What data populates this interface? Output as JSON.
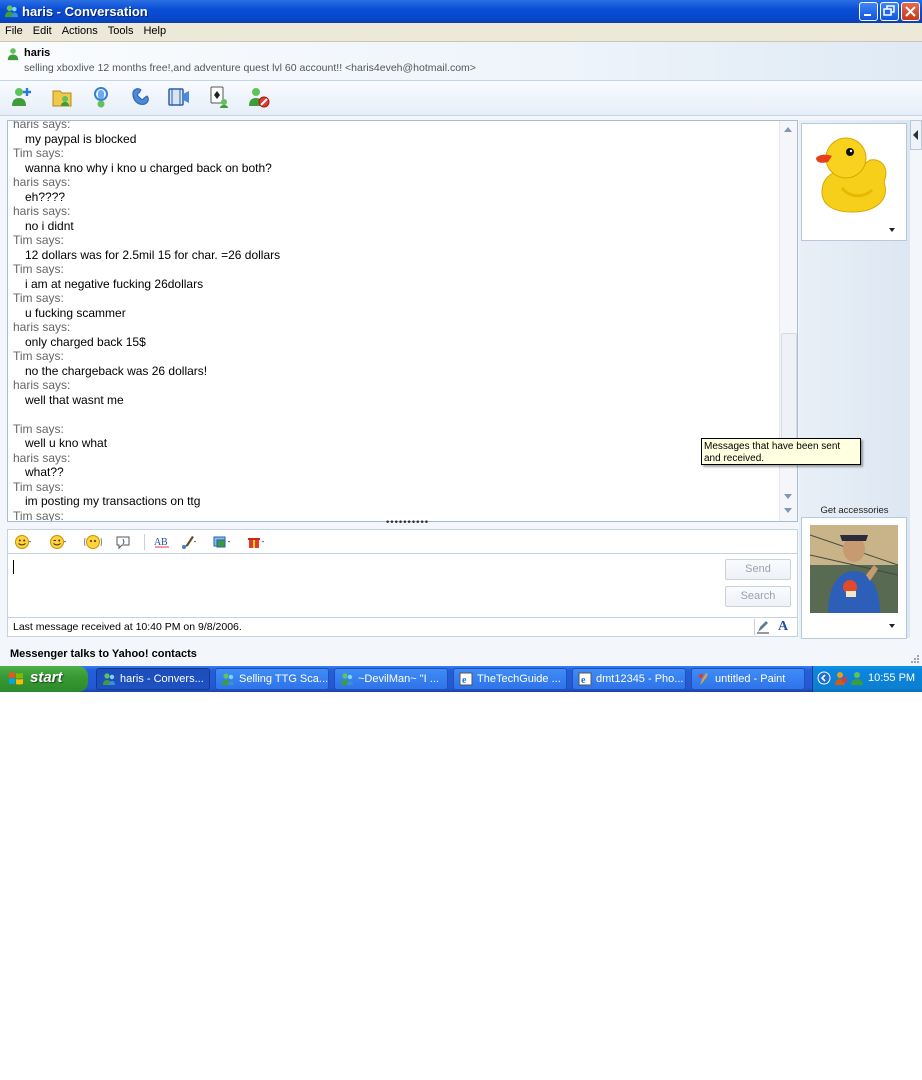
{
  "window": {
    "title": "haris - Conversation",
    "menu": [
      "File",
      "Edit",
      "Actions",
      "Tools",
      "Help"
    ]
  },
  "contact": {
    "name": "haris",
    "status_message": "selling xboxlive 12 months free!,and adventure quest lvl 60 account!! <haris4eveh@hotmail.com>"
  },
  "toolbar": {
    "icons": [
      "invite-contact",
      "send-files",
      "voice",
      "call",
      "video",
      "activities",
      "block"
    ]
  },
  "conversation": {
    "lines": [
      {
        "type": "says",
        "text": "haris says:"
      },
      {
        "type": "msg",
        "text": "my paypal is blocked"
      },
      {
        "type": "says",
        "text": "Tim says:"
      },
      {
        "type": "msg",
        "text": "wanna kno why i kno u charged back on both?"
      },
      {
        "type": "says",
        "text": "haris says:"
      },
      {
        "type": "msg",
        "text": "eh????"
      },
      {
        "type": "says",
        "text": "haris says:"
      },
      {
        "type": "msg",
        "text": "no i didnt"
      },
      {
        "type": "says",
        "text": "Tim says:"
      },
      {
        "type": "msg",
        "text": "12 dollars was for 2.5mil 15 for char. =26 dollars"
      },
      {
        "type": "says",
        "text": "Tim says:"
      },
      {
        "type": "msg",
        "text": "i am at negative fucking 26dollars"
      },
      {
        "type": "says",
        "text": "Tim says:"
      },
      {
        "type": "msg",
        "text": "u fucking scammer"
      },
      {
        "type": "says",
        "text": "haris says:"
      },
      {
        "type": "msg",
        "text": "only charged back 15$"
      },
      {
        "type": "says",
        "text": "Tim says:"
      },
      {
        "type": "msg",
        "text": "no the chargeback was 26 dollars!"
      },
      {
        "type": "says",
        "text": "haris says:"
      },
      {
        "type": "msg",
        "text": "well that wasnt me"
      },
      {
        "type": "msg",
        "text": ""
      },
      {
        "type": "says",
        "text": "Tim says:"
      },
      {
        "type": "msg",
        "text": "well u kno what"
      },
      {
        "type": "says",
        "text": "haris says:"
      },
      {
        "type": "msg",
        "text": "what??"
      },
      {
        "type": "says",
        "text": "Tim says:"
      },
      {
        "type": "msg",
        "text": "im posting my transactions on ttg"
      },
      {
        "type": "says",
        "text": "Tim says:"
      }
    ]
  },
  "tooltip": "Messages that have been sent and received.",
  "compose": {
    "send_label": "Send",
    "search_label": "Search",
    "status_text": "Last message received at 10:40 PM on 9/8/2006."
  },
  "right_pane": {
    "get_accessories": "Get accessories",
    "contact_picture": "duck",
    "my_picture": "webcam-photo"
  },
  "footer": {
    "ad_text": "Messenger talks to Yahoo! contacts"
  },
  "taskbar": {
    "start_label": "start",
    "tasks": [
      {
        "label": "haris - Convers...",
        "icon": "messenger-icon",
        "active": true
      },
      {
        "label": "Selling TTG Sca...",
        "icon": "messenger-icon",
        "active": false
      },
      {
        "label": "~DevilMan~ \"I ...",
        "icon": "messenger-icon",
        "active": false
      },
      {
        "label": "TheTechGuide ...",
        "icon": "ie-icon",
        "active": false
      },
      {
        "label": "dmt12345 - Pho...",
        "icon": "ie-icon",
        "active": false
      },
      {
        "label": "untitled - Paint",
        "icon": "paint-icon",
        "active": false
      }
    ],
    "clock": "10:55 PM"
  },
  "colors": {
    "titlebar": "#0a4ed6",
    "taskbar": "#245edb",
    "start_green": "#379a34",
    "tooltip_bg": "#ffffe1"
  }
}
